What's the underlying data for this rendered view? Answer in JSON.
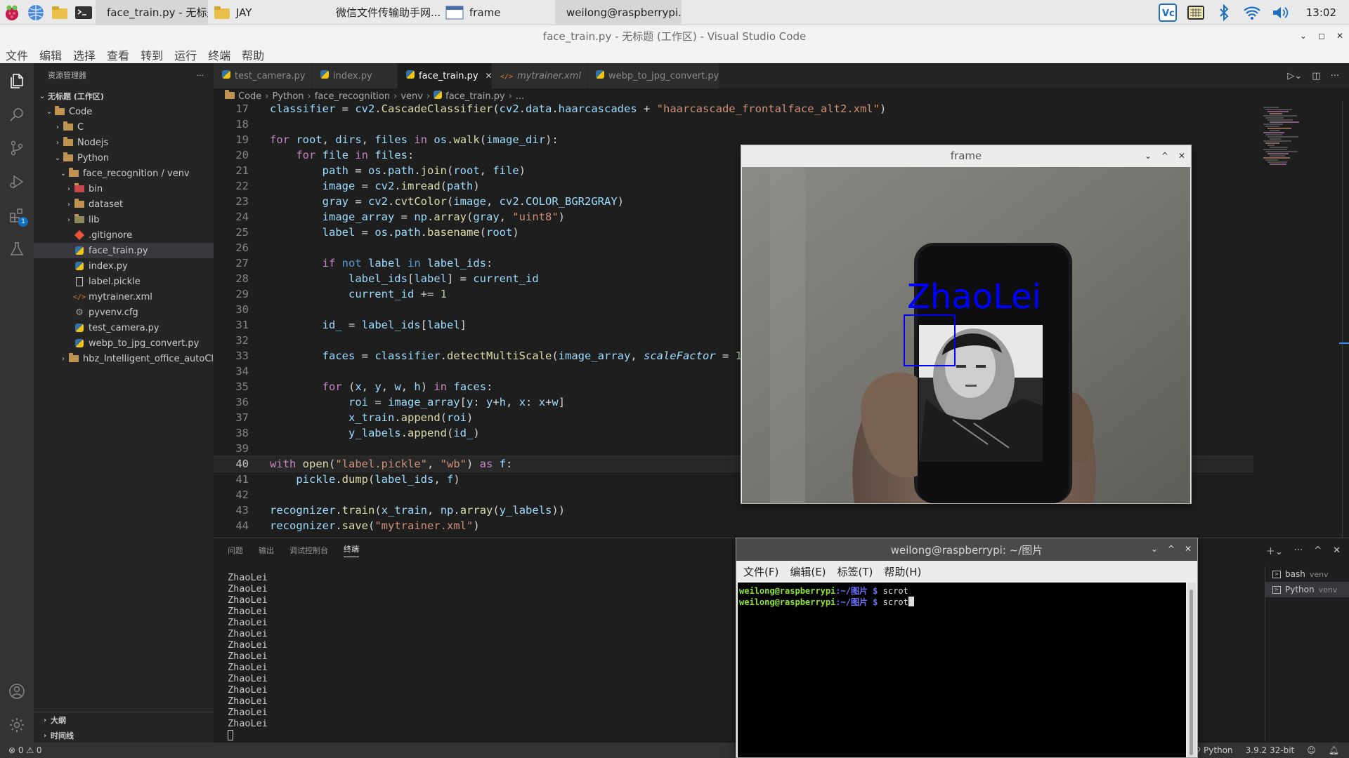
{
  "taskbar": {
    "tasks": [
      {
        "label": "face_train.py - 无标题..."
      },
      {
        "label": "JAY"
      },
      {
        "label": "微信文件传输助手网..."
      },
      {
        "label": "frame"
      },
      {
        "label": "weilong@raspberrypi..."
      }
    ],
    "clock": "13:02"
  },
  "window": {
    "title": "face_train.py - 无标题 (工作区) - Visual Studio Code"
  },
  "menu": [
    "文件",
    "编辑",
    "选择",
    "查看",
    "转到",
    "运行",
    "终端",
    "帮助"
  ],
  "explorer": {
    "title": "资源管理器",
    "more": "···",
    "workspace": "无标题 (工作区)",
    "items": [
      {
        "label": "Code"
      },
      {
        "label": "C"
      },
      {
        "label": "Nodejs"
      },
      {
        "label": "Python"
      },
      {
        "label": "face_recognition / venv"
      },
      {
        "label": "bin"
      },
      {
        "label": "dataset"
      },
      {
        "label": "lib"
      },
      {
        "label": ".gitignore"
      },
      {
        "label": "face_train.py"
      },
      {
        "label": "index.py"
      },
      {
        "label": "label.pickle"
      },
      {
        "label": "mytrainer.xml"
      },
      {
        "label": "pyvenv.cfg"
      },
      {
        "label": "test_camera.py"
      },
      {
        "label": "webp_to_jpg_convert.py"
      },
      {
        "label": "hbz_Intelligent_office_autoClient"
      }
    ],
    "outline": "大纲",
    "timeline": "时间线"
  },
  "extensions_badge": "1",
  "tabs": [
    {
      "label": "test_camera.py"
    },
    {
      "label": "index.py"
    },
    {
      "label": "face_train.py"
    },
    {
      "label": "mytrainer.xml"
    },
    {
      "label": "webp_to_jpg_convert.py"
    }
  ],
  "breadcrumb": [
    "Code",
    "Python",
    "face_recognition",
    "venv",
    "face_train.py",
    "..."
  ],
  "code": {
    "line_numbers": [
      "17",
      "18",
      "19",
      "20",
      "21",
      "22",
      "23",
      "24",
      "25",
      "26",
      "27",
      "28",
      "29",
      "30",
      "31",
      "32",
      "33",
      "34",
      "35",
      "36",
      "37",
      "38",
      "39",
      "40",
      "41",
      "42",
      "43",
      "44"
    ]
  },
  "panel": {
    "tabs": [
      "问题",
      "输出",
      "调试控制台",
      "终端"
    ],
    "output": [
      "ZhaoLei",
      "ZhaoLei",
      "ZhaoLei",
      "ZhaoLei",
      "ZhaoLei",
      "ZhaoLei",
      "ZhaoLei",
      "ZhaoLei",
      "ZhaoLei",
      "ZhaoLei",
      "ZhaoLei",
      "ZhaoLei",
      "ZhaoLei",
      "ZhaoLei"
    ],
    "terminals": [
      {
        "name": "bash",
        "sub": "venv"
      },
      {
        "name": "Python",
        "sub": "venv"
      }
    ]
  },
  "status": {
    "problems": "⊗ 0 ⚠ 0",
    "language": "Python",
    "interpreter": "3.9.2 32-bit"
  },
  "frame": {
    "title": "frame",
    "label": "ZhaoLei"
  },
  "terminal": {
    "title": "weilong@raspberrypi: ~/图片",
    "menu": [
      "文件(F)",
      "编辑(E)",
      "标签(T)",
      "帮助(H)"
    ],
    "lines": [
      {
        "user": "weilong@raspberrypi",
        "path": ":~/图片 $",
        "cmd": "scrot"
      },
      {
        "user": "weilong@raspberrypi",
        "path": ":~/图片 $",
        "cmd": "scrot"
      }
    ]
  },
  "colors": {
    "accent": "#0e70c0",
    "face_box": "#0000ff",
    "terminal_user": "#8ae234"
  }
}
